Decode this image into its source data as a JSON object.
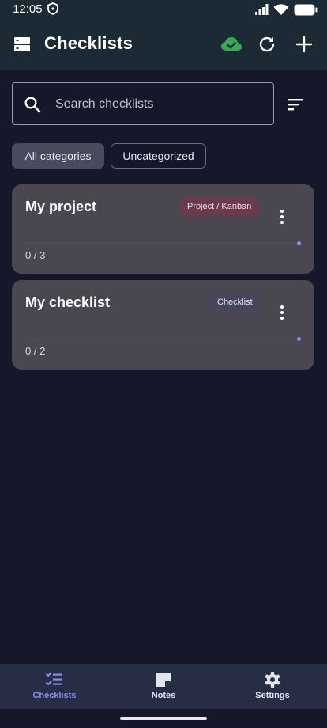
{
  "status": {
    "time": "12:05",
    "icons": [
      "shield-icon",
      "signal-icon",
      "wifi-icon",
      "battery-icon"
    ]
  },
  "app_bar": {
    "title": "Checklists",
    "icons": [
      "storage-menu-icon",
      "cloud-sync-ok-icon",
      "refresh-icon",
      "add-icon"
    ],
    "sync_color": "#3aa657"
  },
  "search": {
    "placeholder": "Search checklists",
    "value": ""
  },
  "filters": [
    {
      "label": "All categories",
      "selected": true
    },
    {
      "label": "Uncategorized",
      "selected": false
    }
  ],
  "checklists": [
    {
      "title": "My project",
      "category": "Project / Kanban",
      "progress": "0 / 3"
    },
    {
      "title": "My checklist",
      "category": "Checklist",
      "progress": "0 / 2"
    }
  ],
  "bottom_nav": {
    "items": [
      {
        "label": "Checklists",
        "icon": "checklist-icon",
        "active": true
      },
      {
        "label": "Notes",
        "icon": "note-icon",
        "active": false
      },
      {
        "label": "Settings",
        "icon": "gear-icon",
        "active": false
      }
    ],
    "active_color": "#8c8ff0"
  }
}
